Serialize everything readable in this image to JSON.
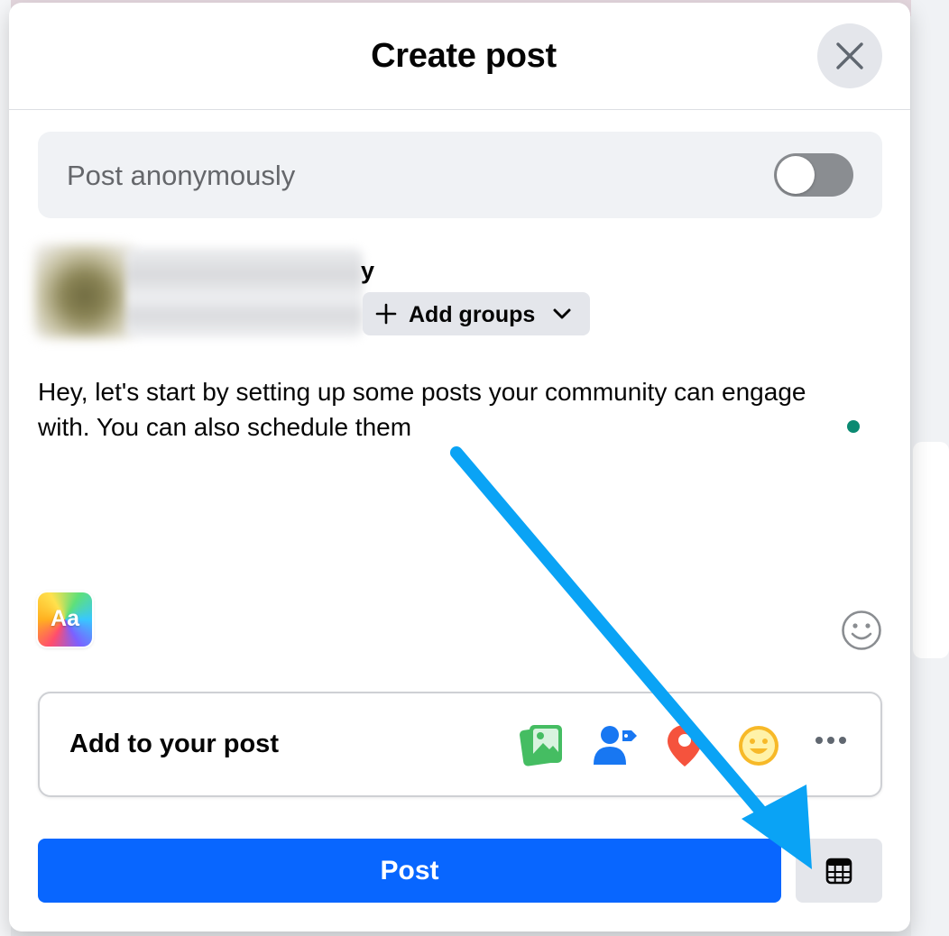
{
  "dialog": {
    "title": "Create post",
    "close_icon": "close-icon"
  },
  "anonymous": {
    "label": "Post anonymously",
    "toggle_on": false
  },
  "author": {
    "name_visible_tail": "y",
    "add_groups_label": "Add groups",
    "plus_icon": "plus-icon",
    "chevron_icon": "chevron-down-icon"
  },
  "composer": {
    "text": "Hey, let's start by setting up some posts your community can engage with. You can also schedule them",
    "text_format_label": "Aa",
    "emoji_icon": "smiley-icon"
  },
  "add_to_post": {
    "label": "Add to your post",
    "icons": [
      "photo-video-icon",
      "tag-people-icon",
      "location-pin-icon",
      "feeling-icon",
      "more-icon"
    ]
  },
  "actions": {
    "post_label": "Post",
    "schedule_icon": "calendar-icon"
  },
  "colors": {
    "primary_blue": "#0866ff",
    "annotation_arrow": "#0aa3f5",
    "status_dot": "#0b8a72"
  }
}
